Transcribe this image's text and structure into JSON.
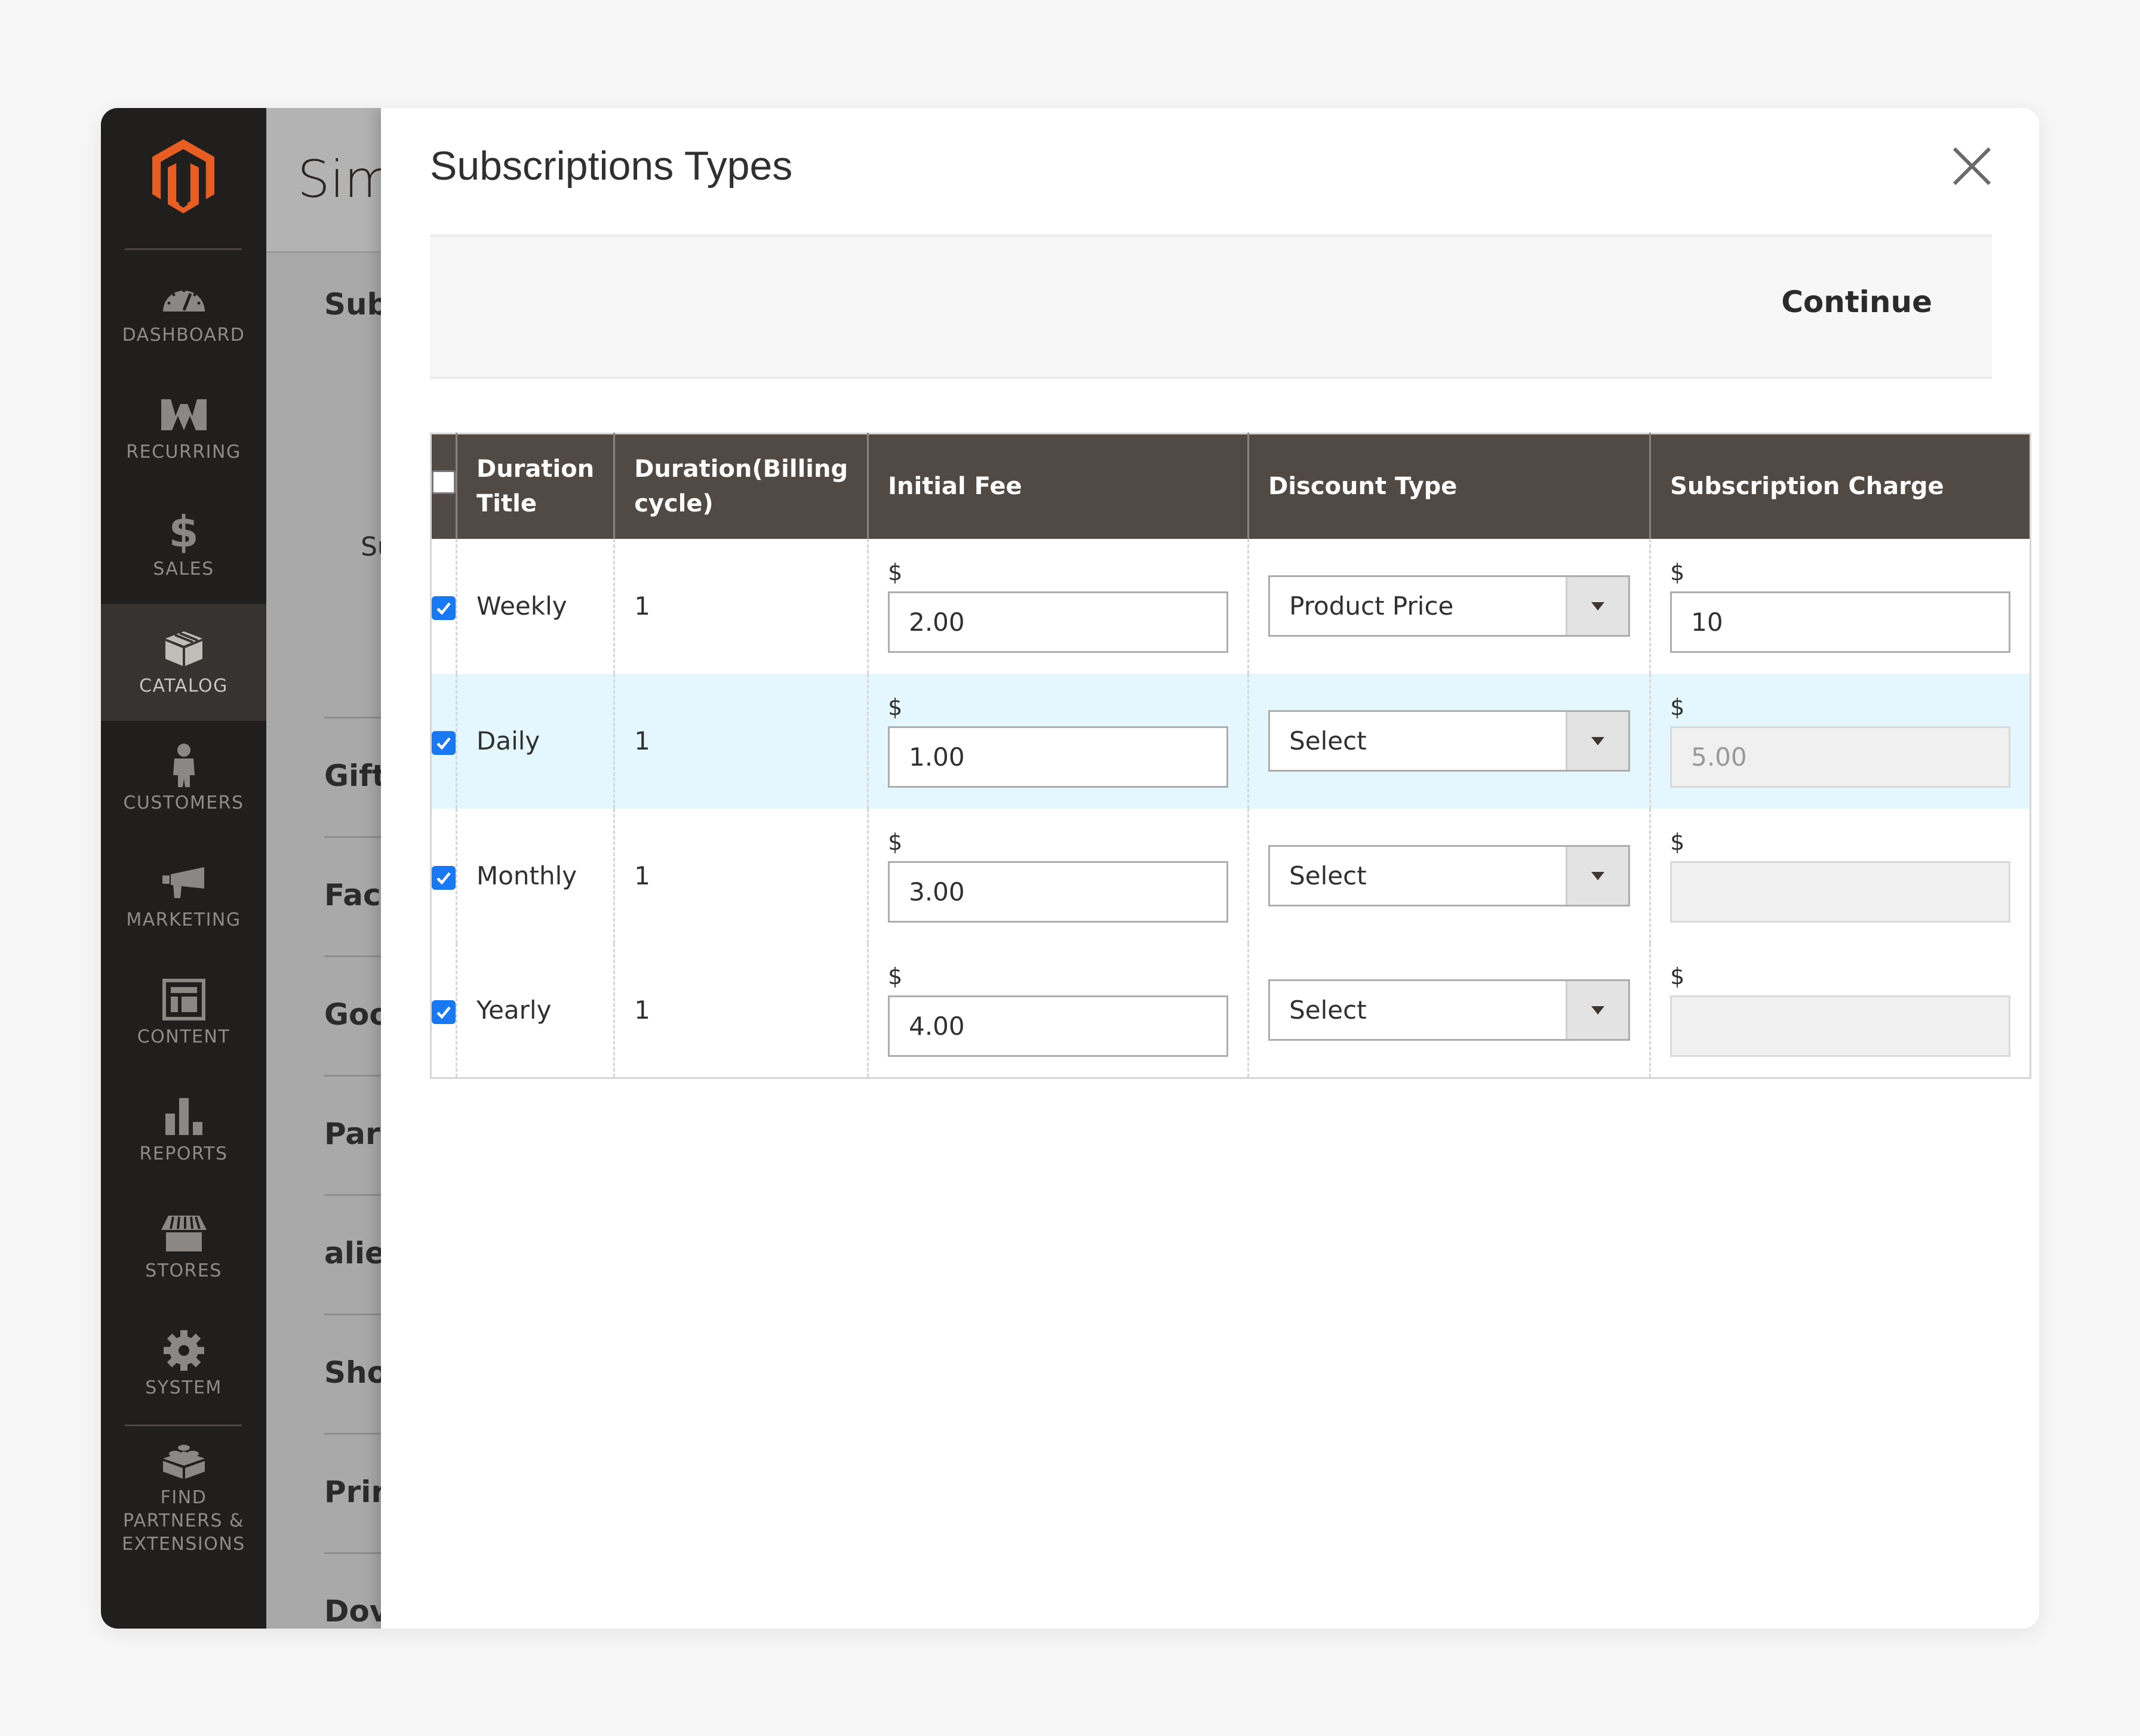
{
  "sidebar": {
    "logo": "magento-logo",
    "items": [
      {
        "label": "Dashboard",
        "icon": "speedometer-icon",
        "active": false
      },
      {
        "label": "Recurring",
        "icon": "recurring-w-icon",
        "active": false
      },
      {
        "label": "Sales",
        "icon": "dollar-icon",
        "active": false
      },
      {
        "label": "Catalog",
        "icon": "box-icon",
        "active": true
      },
      {
        "label": "Customers",
        "icon": "person-icon",
        "active": false
      },
      {
        "label": "Marketing",
        "icon": "megaphone-icon",
        "active": false
      },
      {
        "label": "Content",
        "icon": "layout-icon",
        "active": false
      },
      {
        "label": "Reports",
        "icon": "bar-chart-icon",
        "active": false
      },
      {
        "label": "Stores",
        "icon": "storefront-icon",
        "active": false
      },
      {
        "label": "System",
        "icon": "gear-icon",
        "active": false
      },
      {
        "label": "Find Partners & Extensions",
        "icon": "lego-block-icon",
        "active": false
      }
    ]
  },
  "background_page": {
    "title": "Sim",
    "section_label": "Sub",
    "field_label": "Su",
    "sections": [
      "Gift",
      "Fac",
      "Goo",
      "Par",
      "alie",
      "Sho",
      "Prir",
      "Dov"
    ]
  },
  "modal": {
    "title": "Subscriptions Types",
    "close_icon": "close-icon",
    "continue_label": "Continue",
    "table": {
      "columns": [
        "",
        "Duration Title",
        "Duration(Billing cycle)",
        "Initial Fee",
        "Discount Type",
        "Subscription Charge"
      ],
      "header_checkbox_checked": false,
      "currency_symbol": "$",
      "rows": [
        {
          "checked": true,
          "title": "Weekly",
          "billing_cycle": "1",
          "initial_fee": "2.00",
          "discount_type": "Product Price",
          "subscription_charge": "10",
          "charge_disabled": false,
          "highlighted": false
        },
        {
          "checked": true,
          "title": "Daily",
          "billing_cycle": "1",
          "initial_fee": "1.00",
          "discount_type": "Select",
          "subscription_charge": "5.00",
          "charge_disabled": true,
          "highlighted": true
        },
        {
          "checked": true,
          "title": "Monthly",
          "billing_cycle": "1",
          "initial_fee": "3.00",
          "discount_type": "Select",
          "subscription_charge": "",
          "charge_disabled": true,
          "highlighted": false
        },
        {
          "checked": true,
          "title": "Yearly",
          "billing_cycle": "1",
          "initial_fee": "4.00",
          "discount_type": "Select",
          "subscription_charge": "",
          "charge_disabled": true,
          "highlighted": false
        }
      ]
    }
  },
  "colors": {
    "sidebar_bg": "#201f1e",
    "sidebar_active_bg": "#373330",
    "brand_orange": "#e85d22",
    "table_header_bg": "#514943",
    "checkbox_blue": "#1979f5",
    "row_highlight": "#e5f7fe"
  }
}
